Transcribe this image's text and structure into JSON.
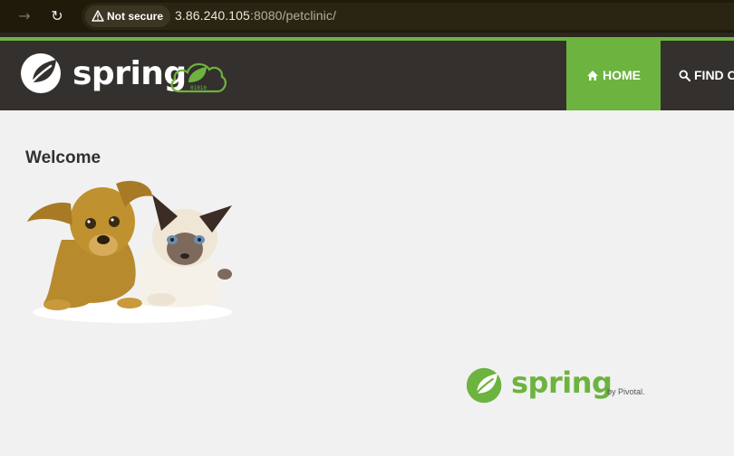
{
  "browser": {
    "security_label": "Not secure",
    "url_host": "3.86.240.105",
    "url_rest": ":8080/petclinic/"
  },
  "header": {
    "brand": "spring",
    "nav": {
      "home_label": "HOME",
      "find_label": "FIND O"
    },
    "cloud_badge_text": "01010"
  },
  "main": {
    "title": "Welcome",
    "image_alt": "pets"
  },
  "footer": {
    "brand": "spring",
    "by": "by Pivotal."
  },
  "colors": {
    "accent": "#6db33f",
    "header_bg": "#34302d",
    "page_bg": "#f1f1f1"
  }
}
